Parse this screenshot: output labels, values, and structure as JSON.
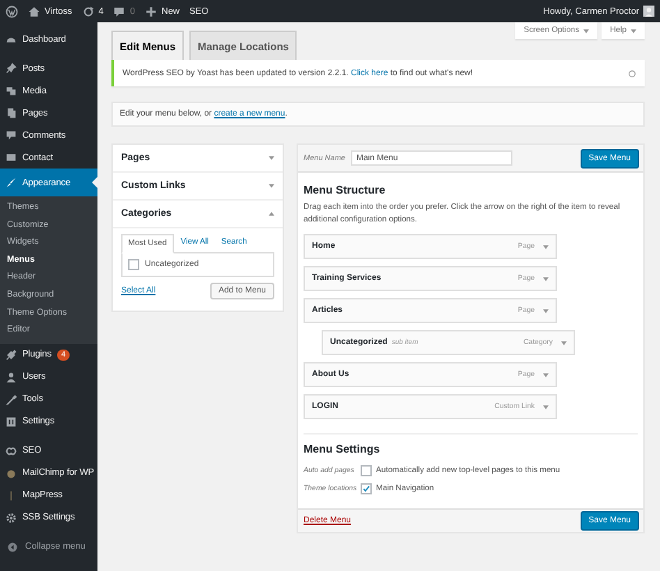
{
  "admin_bar": {
    "site": "Virtoss",
    "updates": "4",
    "comments": "0",
    "new": "New",
    "seo": "SEO",
    "greeting": "Howdy, Carmen Proctor"
  },
  "sidebar": {
    "groups": [
      [
        {
          "label": "Dashboard",
          "selected": false
        }
      ],
      [
        {
          "label": "Posts",
          "selected": false
        },
        {
          "label": "Media",
          "selected": false
        },
        {
          "label": "Pages",
          "selected": false
        },
        {
          "label": "Comments",
          "selected": false
        },
        {
          "label": "Contact",
          "selected": false
        },
        {
          "label": "Appearance",
          "selected": true,
          "children": [
            {
              "label": "Themes",
              "selected": false
            },
            {
              "label": "Customize",
              "selected": false
            },
            {
              "label": "Widgets",
              "selected": false
            },
            {
              "label": "Menus",
              "selected": true
            },
            {
              "label": "Header",
              "selected": false
            },
            {
              "label": "Background",
              "selected": false
            },
            {
              "label": "Theme Options",
              "selected": false
            },
            {
              "label": "Editor",
              "selected": false
            }
          ]
        },
        {
          "label": "Plugins",
          "selected": false,
          "badge": "4"
        },
        {
          "label": "Users",
          "selected": false
        },
        {
          "label": "Tools",
          "selected": false
        },
        {
          "label": "Settings",
          "selected": false
        }
      ],
      [
        {
          "label": "SEO",
          "selected": false
        },
        {
          "label": "MailChimp for WP",
          "selected": false
        },
        {
          "label": "MapPress",
          "selected": false
        },
        {
          "label": "SSB Settings",
          "selected": false
        }
      ]
    ],
    "collapse": "Collapse menu"
  },
  "screen_buttons": [
    "Screen Options",
    "Help"
  ],
  "tabs": [
    {
      "label": "Edit Menus",
      "selected": true
    },
    {
      "label": "Manage Locations",
      "selected": false
    }
  ],
  "notice": {
    "before": "WordPress SEO by Yoast has been updated to version 2.2.1. ",
    "link": "Click here",
    "after": " to find out what's new!"
  },
  "edit_prompt": {
    "before": "Edit your menu below, or ",
    "link": "create a new menu",
    "after": "."
  },
  "accordion": [
    {
      "title": "Pages",
      "expanded": false
    },
    {
      "title": "Custom Links",
      "expanded": false
    },
    {
      "title": "Categories",
      "expanded": true,
      "tabs": [
        {
          "label": "Most Used",
          "selected": true
        },
        {
          "label": "View All",
          "selected": false
        },
        {
          "label": "Search",
          "selected": false
        }
      ],
      "items": [
        {
          "label": "Uncategorized",
          "checked": false
        }
      ],
      "select_all": "Select All",
      "button": "Add to Menu"
    }
  ],
  "menu": {
    "name_label": "Menu Name",
    "name": "Main Menu",
    "save": "Save Menu",
    "structure_title": "Menu Structure",
    "structure_help": "Drag each item into the order you prefer. Click the arrow on the right of the item to reveal additional configuration options.",
    "items": [
      {
        "title": "Home",
        "type": "Page"
      },
      {
        "title": "Training Services",
        "type": "Page"
      },
      {
        "title": "Articles",
        "type": "Page",
        "children": [
          {
            "title": "Uncategorized",
            "note": "sub item",
            "type": "Category"
          }
        ]
      },
      {
        "title": "About Us",
        "type": "Page"
      },
      {
        "title": "LOGIN",
        "type": "Custom Link"
      }
    ],
    "settings_title": "Menu Settings",
    "settings": [
      {
        "label": "Auto add pages",
        "option": "Automatically add new top-level pages to this menu",
        "checked": false
      },
      {
        "label": "Theme locations",
        "option": "Main Navigation",
        "checked": true
      }
    ],
    "delete": "Delete Menu",
    "save_bottom": "Save Menu"
  }
}
